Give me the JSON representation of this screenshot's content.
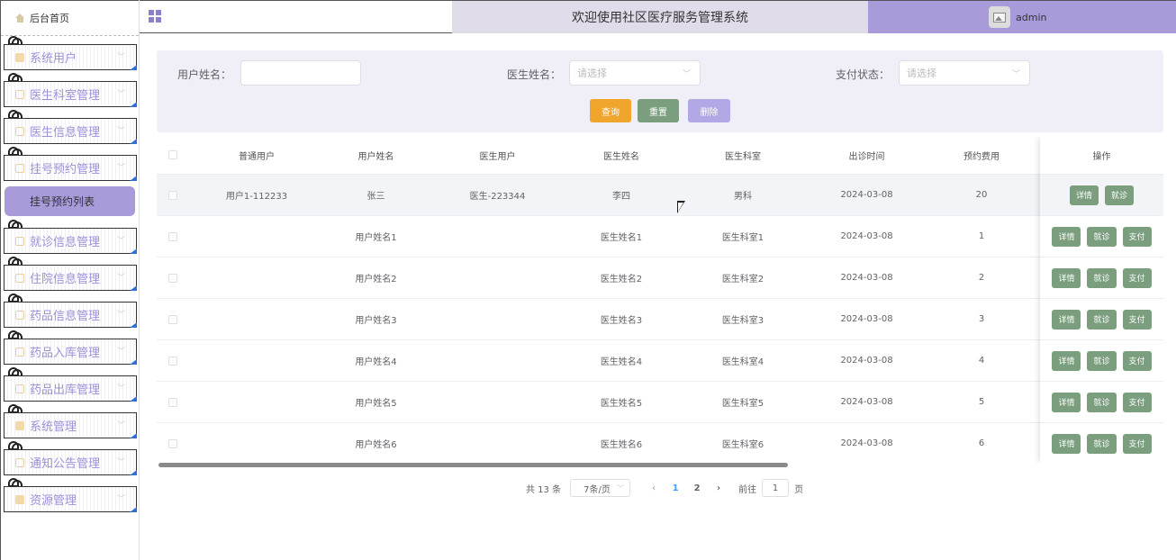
{
  "sidebar": {
    "home_label": "后台首页",
    "items": [
      {
        "label": "系统用户",
        "icon": "user-icon"
      },
      {
        "label": "医生科室管理",
        "icon": "doc-icon"
      },
      {
        "label": "医生信息管理",
        "icon": "doc-icon"
      },
      {
        "label": "挂号预约管理",
        "icon": "doc-icon"
      },
      {
        "label": "就诊信息管理",
        "icon": "doc-icon"
      },
      {
        "label": "住院信息管理",
        "icon": "doc-icon"
      },
      {
        "label": "药品信息管理",
        "icon": "doc-icon"
      },
      {
        "label": "药品入库管理",
        "icon": "doc-icon"
      },
      {
        "label": "药品出库管理",
        "icon": "doc-icon"
      },
      {
        "label": "系统管理",
        "icon": "settings-icon"
      },
      {
        "label": "通知公告管理",
        "icon": "info-icon"
      },
      {
        "label": "资源管理",
        "icon": "resource-icon"
      }
    ],
    "active_sub": "挂号预约列表"
  },
  "header": {
    "title": "欢迎使用社区医疗服务管理系统",
    "username": "admin"
  },
  "filter": {
    "user_name_label": "用户姓名：",
    "user_name_value": "",
    "doctor_name_label": "医生姓名：",
    "doctor_name_placeholder": "请选择",
    "pay_status_label": "支付状态：",
    "pay_status_placeholder": "请选择",
    "query_btn": "查询",
    "reset_btn": "重置",
    "delete_btn": "删除"
  },
  "table": {
    "columns": [
      "普通用户",
      "用户姓名",
      "医生用户",
      "医生姓名",
      "医生科室",
      "出诊时间",
      "预约费用",
      "操作"
    ],
    "rows": [
      {
        "user": "用户1-112233",
        "name": "张三",
        "doctor_user": "医生-223344",
        "doctor_name": "李四",
        "dept": "男科",
        "time": "2024-03-08",
        "fee": "20",
        "actions": [
          "详情",
          "就诊"
        ]
      },
      {
        "user": "",
        "name": "用户姓名1",
        "doctor_user": "",
        "doctor_name": "医生姓名1",
        "dept": "医生科室1",
        "time": "2024-03-08",
        "fee": "1",
        "actions": [
          "详情",
          "就诊",
          "支付"
        ]
      },
      {
        "user": "",
        "name": "用户姓名2",
        "doctor_user": "",
        "doctor_name": "医生姓名2",
        "dept": "医生科室2",
        "time": "2024-03-08",
        "fee": "2",
        "actions": [
          "详情",
          "就诊",
          "支付"
        ]
      },
      {
        "user": "",
        "name": "用户姓名3",
        "doctor_user": "",
        "doctor_name": "医生姓名3",
        "dept": "医生科室3",
        "time": "2024-03-08",
        "fee": "3",
        "actions": [
          "详情",
          "就诊",
          "支付"
        ]
      },
      {
        "user": "",
        "name": "用户姓名4",
        "doctor_user": "",
        "doctor_name": "医生姓名4",
        "dept": "医生科室4",
        "time": "2024-03-08",
        "fee": "4",
        "actions": [
          "详情",
          "就诊",
          "支付"
        ]
      },
      {
        "user": "",
        "name": "用户姓名5",
        "doctor_user": "",
        "doctor_name": "医生姓名5",
        "dept": "医生科室5",
        "time": "2024-03-08",
        "fee": "5",
        "actions": [
          "详情",
          "就诊",
          "支付"
        ]
      },
      {
        "user": "",
        "name": "用户姓名6",
        "doctor_user": "",
        "doctor_name": "医生姓名6",
        "dept": "医生科室6",
        "time": "2024-03-08",
        "fee": "6",
        "actions": [
          "详情",
          "就诊",
          "支付"
        ]
      }
    ]
  },
  "pagination": {
    "total": "共 13 条",
    "page_size": "7条/页",
    "pages": [
      "1",
      "2"
    ],
    "current": "1",
    "goto_label": "前往",
    "goto_value": "1",
    "page_suffix": "页"
  },
  "colors": {
    "accent": "#a99ad9",
    "query": "#f0a52c",
    "reset": "#7a9e7e",
    "delete": "#b3a8e6",
    "action": "#7a9e7e"
  }
}
